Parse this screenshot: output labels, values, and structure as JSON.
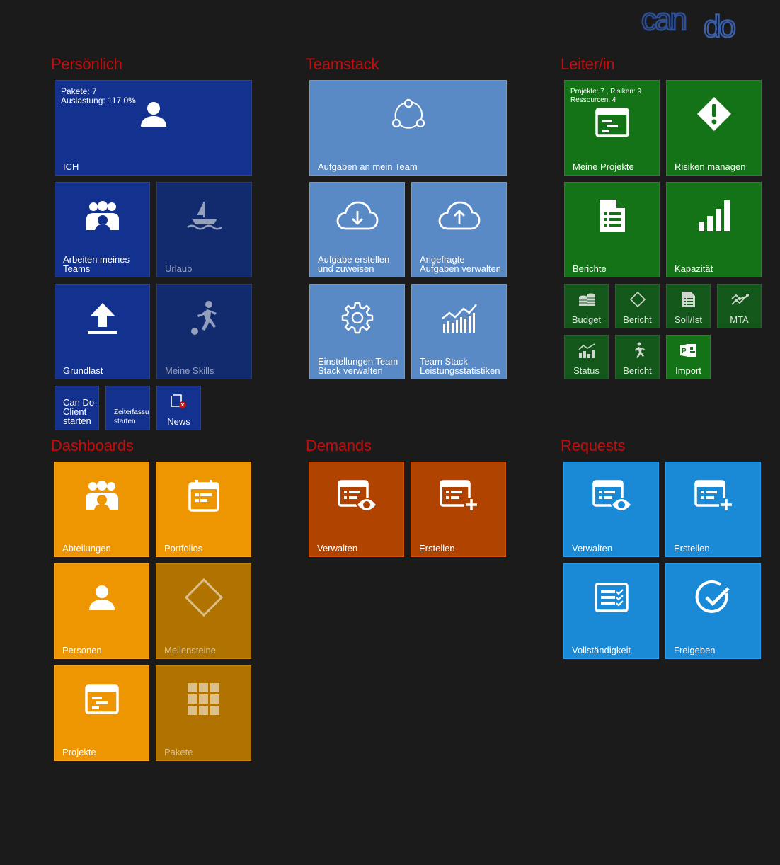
{
  "logo": {
    "text": "cando",
    "accent": "#2e4f93"
  },
  "colors": {
    "section_title": "#c10d0d",
    "navy": "#13318e",
    "steel": "#5a8ac6",
    "green": "#147316",
    "orange": "#ee9601",
    "rust": "#b14300",
    "blue": "#1b8ad6"
  },
  "sections": {
    "personal": "Persönlich",
    "teamstack": "Teamstack",
    "leader": "Leiter/in",
    "dashboards": "Dashboards",
    "demands": "Demands",
    "requests": "Requests"
  },
  "personal": {
    "me": {
      "info": "Pakete: 7\nAuslastung: 117.0%",
      "label": "ICH",
      "icon": "user-icon"
    },
    "team_work": {
      "label": "Arbeiten meines\nTeams",
      "icon": "group-icon"
    },
    "vacation": {
      "label": "Urlaub",
      "icon": "sailboat-icon"
    },
    "baseload": {
      "label": "Grundlast",
      "icon": "upload-arrow-icon"
    },
    "skills": {
      "label": "Meine Skills",
      "icon": "soccer-player-icon"
    },
    "client": {
      "label": "Can Do-\nClient\nstarten"
    },
    "time_tracking": {
      "label": "Zeiterfassu\nstarten"
    },
    "news": {
      "label": "News",
      "icon": "news-icon"
    }
  },
  "teamstack": {
    "assign_team": {
      "label": "Aufgaben an mein Team",
      "icon": "network-icon"
    },
    "create_assign": {
      "label": "Aufgabe erstellen\nund zuweisen",
      "icon": "cloud-download-icon"
    },
    "requested_tasks": {
      "label": "Angefragte\nAufgaben verwalten",
      "icon": "cloud-upload-icon"
    },
    "settings": {
      "label": "Einstellungen Team\nStack verwalten",
      "icon": "gear-icon"
    },
    "statistics": {
      "label": "Team Stack\nLeistungsstatistiken",
      "icon": "statistics-icon"
    }
  },
  "leader": {
    "my_projects": {
      "info": "Projekte: 7 , Risiken: 9\nRessourcen: 4",
      "label": "Meine Projekte",
      "icon": "project-card-icon"
    },
    "risks": {
      "label": "Risiken managen",
      "icon": "warning-diamond-icon"
    },
    "reports": {
      "label": "Berichte",
      "icon": "report-document-icon"
    },
    "capacity": {
      "label": "Kapazität",
      "icon": "bar-chart-icon"
    },
    "budget": {
      "label": "Budget",
      "icon": "coins-icon"
    },
    "report1": {
      "label": "Bericht",
      "icon": "diamond-icon"
    },
    "target_actual": {
      "label": "Soll/Ist",
      "icon": "list-document-icon"
    },
    "mta": {
      "label": "MTA",
      "icon": "trend-lines-icon"
    },
    "status": {
      "label": "Status",
      "icon": "status-chart-icon"
    },
    "report2": {
      "label": "Bericht",
      "icon": "runner-icon"
    },
    "import": {
      "label": "Import",
      "icon": "project-import-icon"
    }
  },
  "dashboards": {
    "departments": {
      "label": "Abteilungen",
      "icon": "group-icon"
    },
    "portfolios": {
      "label": "Portfolios",
      "icon": "calendar-icon"
    },
    "persons": {
      "label": "Personen",
      "icon": "user-icon"
    },
    "milestones": {
      "label": "Meilensteine",
      "icon": "diamond-icon"
    },
    "projects": {
      "label": "Projekte",
      "icon": "project-card-icon"
    },
    "packages": {
      "label": "Pakete",
      "icon": "grid-icon"
    }
  },
  "demands": {
    "manage": {
      "label": "Verwalten",
      "icon": "list-view-icon"
    },
    "create": {
      "label": "Erstellen",
      "icon": "list-add-icon"
    }
  },
  "requests": {
    "manage": {
      "label": "Verwalten",
      "icon": "list-view-icon"
    },
    "create": {
      "label": "Erstellen",
      "icon": "list-add-icon"
    },
    "completeness": {
      "label": "Vollständigkeit",
      "icon": "checklist-icon"
    },
    "approve": {
      "label": "Freigeben",
      "icon": "check-circle-icon"
    }
  }
}
